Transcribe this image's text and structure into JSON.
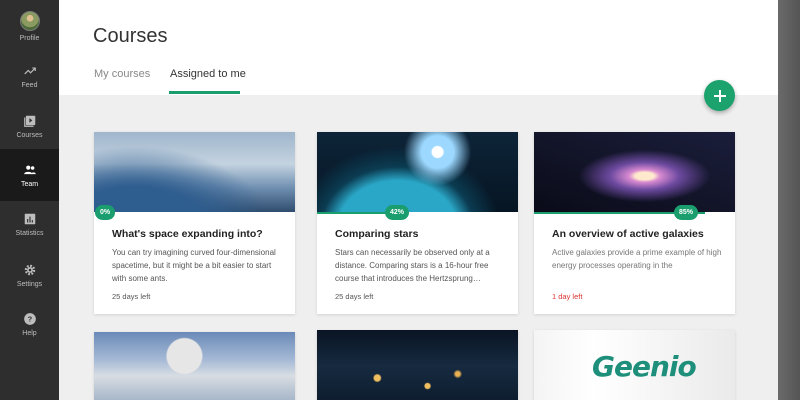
{
  "sidebar": {
    "items": [
      {
        "label": "Profile",
        "icon": "avatar"
      },
      {
        "label": "Feed",
        "icon": "trend-icon"
      },
      {
        "label": "Courses",
        "icon": "play-icon"
      },
      {
        "label": "Team",
        "icon": "people-icon"
      },
      {
        "label": "Statistics",
        "icon": "chart-icon"
      },
      {
        "label": "Settings",
        "icon": "gear-icon"
      },
      {
        "label": "Help",
        "icon": "help-icon"
      }
    ],
    "active": "Team"
  },
  "header": {
    "title": "Courses",
    "tabs": [
      {
        "label": "My courses",
        "active": false
      },
      {
        "label": "Assigned to me",
        "active": true
      }
    ]
  },
  "colors": {
    "accent": "#1a9e6e",
    "alert": "#d33333"
  },
  "courses": [
    {
      "title": "What's space expanding into?",
      "description": "You can try imagining curved four-dimensional spacetime, but it might be a bit easier to start with some ants.",
      "progress": "0%",
      "days_left": "25 days left"
    },
    {
      "title": "Comparing stars",
      "description": "Stars can necessarily be observed only at a distance. Comparing stars is a 16-hour free course that introduces the Hertzsprung…",
      "progress": "42%",
      "days_left": "25 days left"
    },
    {
      "title": "An overview of active galaxies",
      "description": "Active galaxies provide a prime example of high energy processes operating in the",
      "progress": "85%",
      "days_left": "1  day left"
    },
    {
      "image": "astronaut"
    },
    {
      "image": "earth-at-night"
    },
    {
      "image": "geenio",
      "logo_text": "Geenio"
    }
  ]
}
